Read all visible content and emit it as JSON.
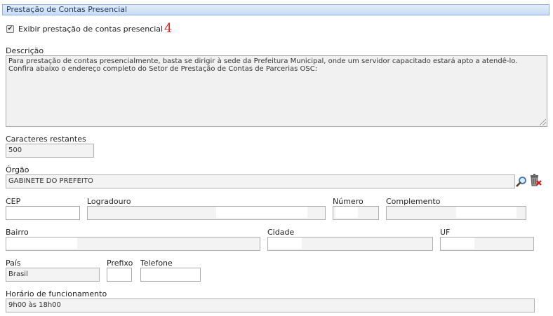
{
  "section": {
    "title": "Prestação de Contas Presencial"
  },
  "show_option": {
    "label": "Exibir prestação de contas presencial",
    "checked": true,
    "marker": "4"
  },
  "descricao": {
    "label": "Descrição",
    "value": "Para prestação de contas presencialmente, basta se dirigir à sede da Prefeitura Municipal, onde um servidor capacitado estará apto a atendê-lo. Confira abaixo o endereço completo do Setor de Prestação de Contas de Parcerias OSC:"
  },
  "caracteres": {
    "label": "Caracteres restantes",
    "value": "500"
  },
  "orgao": {
    "label": "Órgão",
    "value": "GABINETE DO PREFEITO",
    "search_icon": "magnifier-icon",
    "clear_icon": "trash-icon"
  },
  "cep": {
    "label": "CEP",
    "value": ""
  },
  "logradouro": {
    "label": "Logradouro",
    "value": ""
  },
  "numero": {
    "label": "Número",
    "value": ""
  },
  "complemento": {
    "label": "Complemento",
    "value": ""
  },
  "bairro": {
    "label": "Bairro",
    "value": ""
  },
  "cidade": {
    "label": "Cidade",
    "value": ""
  },
  "uf": {
    "label": "UF",
    "value": ""
  },
  "pais": {
    "label": "País",
    "value": "Brasil"
  },
  "prefixo": {
    "label": "Prefixo",
    "value": ""
  },
  "telefone": {
    "label": "Telefone",
    "value": ""
  },
  "horario": {
    "label": "Horário de funcionamento",
    "value": "9h00 às 18h00"
  }
}
